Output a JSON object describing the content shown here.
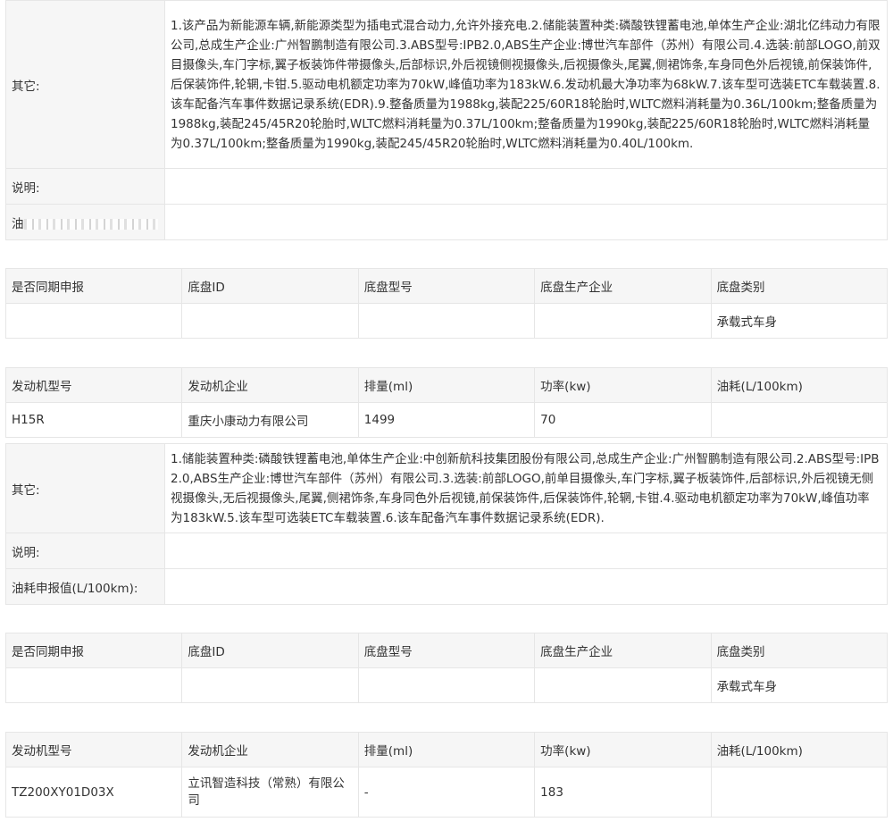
{
  "block1": {
    "other_label": "其它:",
    "other_text": "1.该产品为新能源车辆,新能源类型为插电式混合动力,允许外接充电.2.储能装置种类:磷酸铁锂蓄电池,单体生产企业:湖北亿纬动力有限公司,总成生产企业:广州智鹏制造有限公司.3.ABS型号:IPB2.0,ABS生产企业:博世汽车部件（苏州）有限公司.4.选装:前部LOGO,前双目摄像头,车门字标,翼子板装饰件带摄像头,后部标识,外后视镜侧视摄像头,后视摄像头,尾翼,侧裙饰条,车身同色外后视镜,前保装饰件,后保装饰件,轮辋,卡钳.5.驱动电机额定功率为70kW,峰值功率为183kW.6.发动机最大净功率为68kW.7.该车型可选装ETC车载装置.8.该车配备汽车事件数据记录系统(EDR).9.整备质量为1988kg,装配225/60R18轮胎时,WLTC燃料消耗量为0.36L/100km;整备质量为1988kg,装配245/45R20轮胎时,WLTC燃料消耗量为0.37L/100km;整备质量为1990kg,装配225/60R18轮胎时,WLTC燃料消耗量为0.37L/100km;整备质量为1990kg,装配245/45R20轮胎时,WLTC燃料消耗量为0.40L/100km.",
    "note_label": "说明:",
    "note_value": "",
    "third_label_visible": "油",
    "third_value": ""
  },
  "chassis1": {
    "headers": [
      "是否同期申报",
      "底盘ID",
      "底盘型号",
      "底盘生产企业",
      "底盘类别"
    ],
    "row": [
      "",
      "",
      "",
      "",
      "承载式车身"
    ]
  },
  "engine1": {
    "headers": [
      "发动机型号",
      "发动机企业",
      "排量(ml)",
      "功率(kw)",
      "油耗(L/100km)"
    ],
    "row": [
      "H15R",
      "重庆小康动力有限公司",
      "1499",
      "70",
      ""
    ]
  },
  "block2": {
    "other_label": "其它:",
    "other_text": "1.储能装置种类:磷酸铁锂蓄电池,单体生产企业:中创新航科技集团股份有限公司,总成生产企业:广州智鹏制造有限公司.2.ABS型号:IPB2.0,ABS生产企业:博世汽车部件（苏州）有限公司.3.选装:前部LOGO,前单目摄像头,车门字标,翼子板装饰件,后部标识,外后视镜无侧视摄像头,无后视摄像头,尾翼,侧裙饰条,车身同色外后视镜,前保装饰件,后保装饰件,轮辋,卡钳.4.驱动电机额定功率为70kW,峰值功率为183kW.5.该车型可选装ETC车载装置.6.该车配备汽车事件数据记录系统(EDR).",
    "note_label": "说明:",
    "note_value": "",
    "fuel_label": "油耗申报值(L/100km):",
    "fuel_value": ""
  },
  "chassis2": {
    "headers": [
      "是否同期申报",
      "底盘ID",
      "底盘型号",
      "底盘生产企业",
      "底盘类别"
    ],
    "row": [
      "",
      "",
      "",
      "",
      "承载式车身"
    ]
  },
  "engine2": {
    "headers": [
      "发动机型号",
      "发动机企业",
      "排量(ml)",
      "功率(kw)",
      "油耗(L/100km)"
    ],
    "row": [
      "TZ200XY01D03X",
      "立讯智造科技（常熟）有限公司",
      "-",
      "183",
      ""
    ]
  }
}
